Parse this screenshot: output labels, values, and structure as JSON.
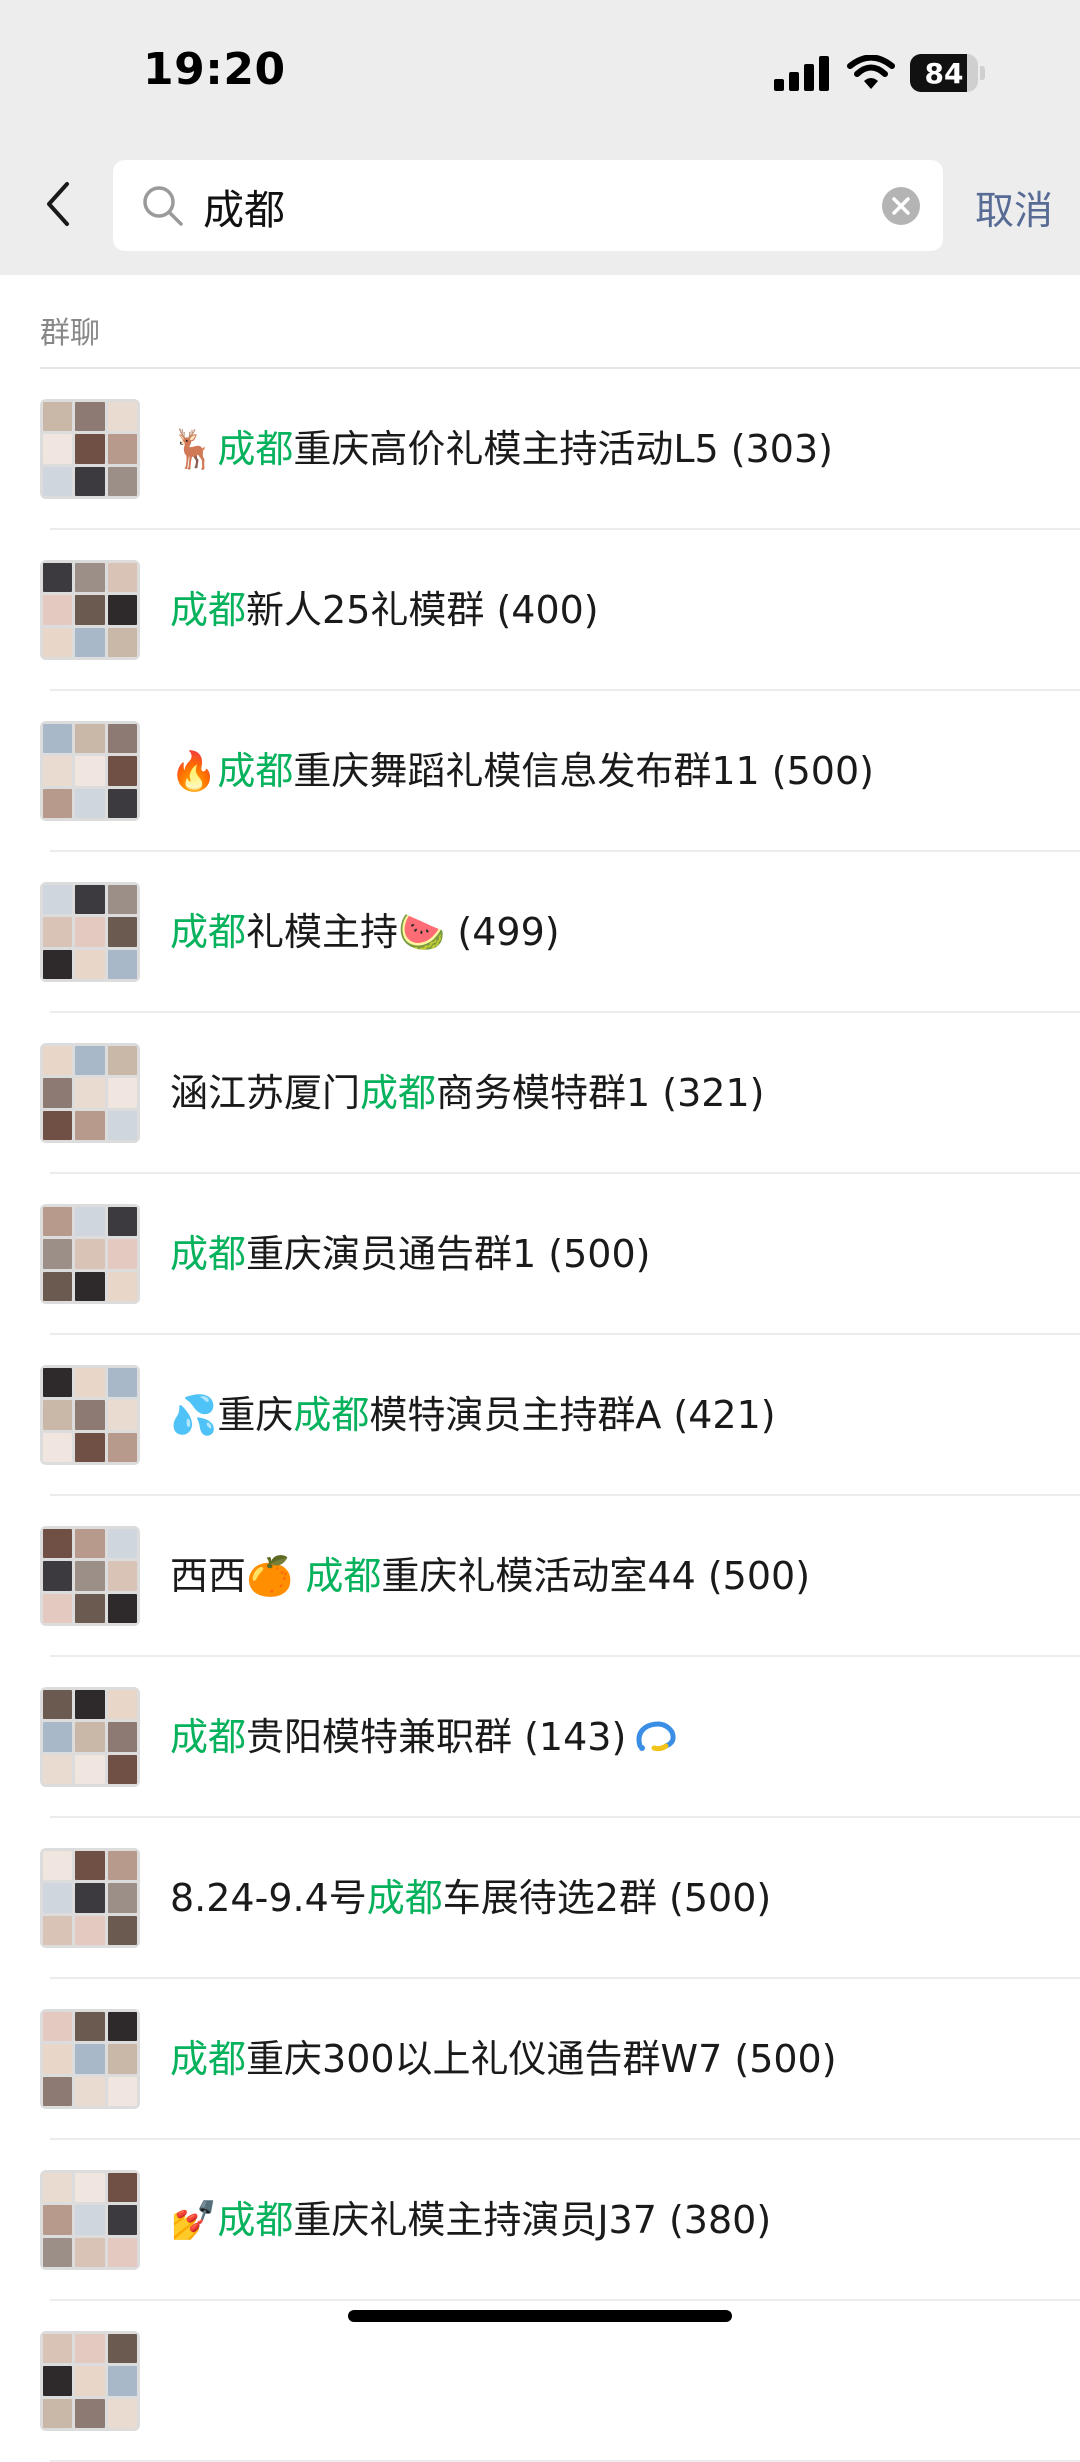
{
  "status_bar": {
    "time": "19:20",
    "battery": "84",
    "battery_level": 0.84
  },
  "search": {
    "query": "成都",
    "placeholder": "",
    "cancel_label": "取消"
  },
  "section": {
    "title": "群聊"
  },
  "highlight_color": "#07b25d",
  "groups": [
    {
      "prefix": "🦌",
      "highlight": "成都",
      "suffix": "重庆高价礼模主持活动L5 (303)",
      "badge_icon": ""
    },
    {
      "prefix": "",
      "highlight": "成都",
      "suffix": "新人25礼模群 (400)",
      "badge_icon": ""
    },
    {
      "prefix": "🔥",
      "highlight": "成都",
      "suffix": "重庆舞蹈礼模信息发布群11 (500)",
      "badge_icon": ""
    },
    {
      "prefix": "",
      "highlight": "成都",
      "suffix": "礼模主持🍉 (499)",
      "badge_icon": ""
    },
    {
      "prefix": "涵江苏厦门",
      "highlight": "成都",
      "suffix": "商务模特群1 (321)",
      "badge_icon": ""
    },
    {
      "prefix": "",
      "highlight": "成都",
      "suffix": "重庆演员通告群1 (500)",
      "badge_icon": ""
    },
    {
      "prefix": "💦重庆",
      "highlight": "成都",
      "suffix": "模特演员主持群A (421)",
      "badge_icon": ""
    },
    {
      "prefix": "西西🍊 ",
      "highlight": "成都",
      "suffix": "重庆礼模活动室44 (500)",
      "badge_icon": ""
    },
    {
      "prefix": "",
      "highlight": "成都",
      "suffix": "贵阳模特兼职群 (143)",
      "badge_icon": "group-chat-ring-icon"
    },
    {
      "prefix": "8.24-9.4号",
      "highlight": "成都",
      "suffix": "车展待选2群 (500)",
      "badge_icon": ""
    },
    {
      "prefix": "",
      "highlight": "成都",
      "suffix": "重庆300以上礼仪通告群W7 (500)",
      "badge_icon": ""
    },
    {
      "prefix": "💅",
      "highlight": "成都",
      "suffix": "重庆礼模主持演员J37 (380)",
      "badge_icon": ""
    },
    {
      "prefix": "",
      "highlight": "",
      "suffix": "",
      "badge_icon": ""
    }
  ]
}
